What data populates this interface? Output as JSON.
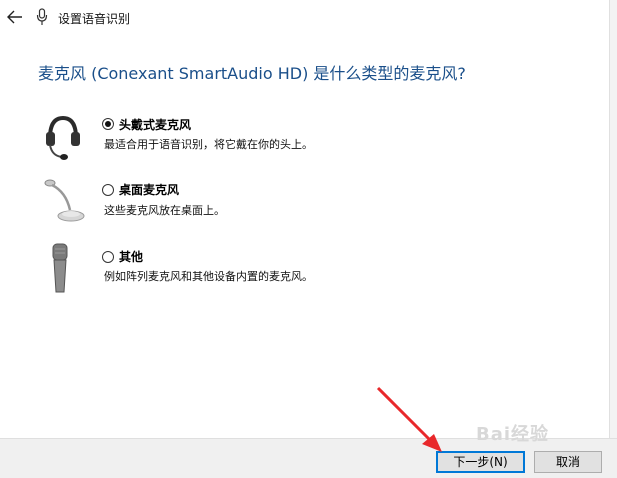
{
  "window": {
    "title": "设置语音识别",
    "back_icon": "back-arrow-icon",
    "title_icon": "microphone-icon"
  },
  "main": {
    "heading": "麦克风 (Conexant SmartAudio HD) 是什么类型的麦克风?",
    "options": [
      {
        "label": "头戴式麦克风",
        "description": "最适合用于语音识别，将它戴在你的头上。",
        "selected": true,
        "icon": "headset-microphone-icon"
      },
      {
        "label": "桌面麦克风",
        "description": "这些麦克风放在桌面上。",
        "selected": false,
        "icon": "desktop-microphone-icon"
      },
      {
        "label": "其他",
        "description": "例如阵列麦克风和其他设备内置的麦克风。",
        "selected": false,
        "icon": "handheld-microphone-icon"
      }
    ]
  },
  "footer": {
    "next_label": "下一步(N)",
    "cancel_label": "取消"
  },
  "overlay": {
    "watermark": "Bai经验",
    "arrow_color": "#e8282b"
  },
  "colors": {
    "heading": "#1a4f8a",
    "primary_border": "#0078d7"
  }
}
